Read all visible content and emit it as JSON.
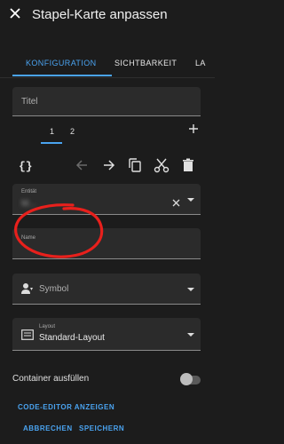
{
  "header": {
    "title": "Stapel-Karte anpassen",
    "close_icon": "close-icon"
  },
  "tabs": [
    {
      "label": "KONFIGURATION",
      "active": true
    },
    {
      "label": "SICHTBARKEIT",
      "active": false
    },
    {
      "label": "LA",
      "active": false
    }
  ],
  "title_field": {
    "placeholder": "Titel",
    "value": ""
  },
  "card_tabs": {
    "items": [
      "1",
      "2"
    ],
    "selected": "1",
    "add_icon": "plus-icon"
  },
  "toolbar": {
    "icons": [
      "code-braces-icon",
      "arrow-left-icon",
      "arrow-right-icon",
      "copy-icon",
      "cut-icon",
      "delete-icon"
    ]
  },
  "entity_field": {
    "label": "Entität",
    "value": "M...",
    "clear_icon": "close-icon",
    "dropdown_icon": "chevron-down-icon"
  },
  "name_field": {
    "label": "Name",
    "value": ""
  },
  "symbol_field": {
    "placeholder": "Symbol",
    "icon": "account-icon"
  },
  "layout_field": {
    "label": "Layout",
    "value": "Standard-Layout",
    "icon": "layout-icon"
  },
  "container_toggle": {
    "label": "Container ausfüllen",
    "on": false
  },
  "footer": {
    "code_editor_label": "CODE-EDITOR ANZEIGEN",
    "cancel_label": "ABBRECHEN",
    "save_label": "SPEICHERN"
  },
  "colors": {
    "accent": "#4aa3f0",
    "background": "#1c1c1c",
    "field": "#2b2b2b",
    "annotation": "#e8201c"
  }
}
